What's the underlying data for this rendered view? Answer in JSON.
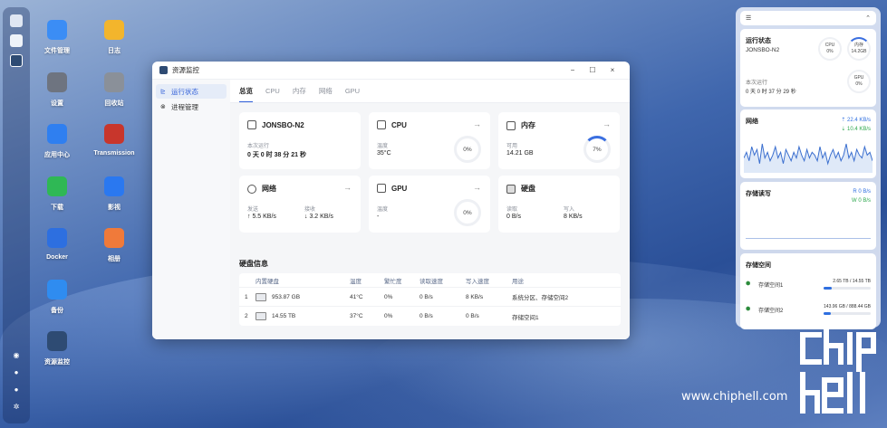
{
  "desktop": {
    "icons": [
      {
        "label": "文件管理",
        "icon": "folder-icon",
        "color": "#3b8df5"
      },
      {
        "label": "日志",
        "icon": "log-icon",
        "color": "#f3b52c"
      },
      {
        "label": "设置",
        "icon": "gear-icon",
        "color": "#6e7480"
      },
      {
        "label": "回收站",
        "icon": "recycle-icon",
        "color": "#8a9099"
      },
      {
        "label": "应用中心",
        "icon": "store-icon",
        "color": "#2f7ff0"
      },
      {
        "label": "Transmission",
        "icon": "transmission-icon",
        "color": "#c8362c"
      },
      {
        "label": "下载",
        "icon": "download-icon",
        "color": "#2fb855"
      },
      {
        "label": "影视",
        "icon": "video-icon",
        "color": "#2a78f0"
      },
      {
        "label": "Docker",
        "icon": "docker-icon",
        "color": "#2d6fe0"
      },
      {
        "label": "相册",
        "icon": "photos-icon",
        "color": "#f07a3a"
      },
      {
        "label": "备份",
        "icon": "backup-icon",
        "color": "#2f8cf0"
      },
      {
        "label": "资源监控",
        "icon": "monitor-icon",
        "color": "#2e4b73"
      }
    ]
  },
  "window": {
    "title": "资源监控",
    "sidebar": [
      {
        "label": "运行状态",
        "icon": "chart-icon"
      },
      {
        "label": "进程管理",
        "icon": "process-icon"
      }
    ],
    "tabs": [
      "总览",
      "CPU",
      "内存",
      "网络",
      "GPU"
    ],
    "cards": {
      "system": {
        "title": "JONSBO-N2",
        "label": "本次运行",
        "value": "0 天 0 时 38 分 21 秒"
      },
      "cpu": {
        "title": "CPU",
        "label": "温度",
        "value": "35°C",
        "gauge": "0%"
      },
      "memory": {
        "title": "内存",
        "label": "可用",
        "value": "14.21 GB",
        "gauge": "7%"
      },
      "network": {
        "title": "网络",
        "send_label": "发送",
        "send": "↑ 5.5 KB/s",
        "recv_label": "接收",
        "recv": "↓ 3.2 KB/s"
      },
      "gpu": {
        "title": "GPU",
        "label": "温度",
        "value": "-",
        "gauge": "0%"
      },
      "disk": {
        "title": "硬盘",
        "read_label": "读取",
        "read": "0 B/s",
        "write_label": "写入",
        "write": "8 KB/s"
      }
    },
    "disk_info": {
      "title": "硬盘信息",
      "headers": [
        "内置硬盘",
        "温度",
        "繁忙度",
        "读取速度",
        "写入速度",
        "用途"
      ],
      "rows": [
        {
          "index": "1",
          "size": "953.87 GB",
          "temp": "41°C",
          "busy": "0%",
          "read": "0 B/s",
          "write": "8 KB/s",
          "usage": "系统分区、存储空间2"
        },
        {
          "index": "2",
          "size": "14.55 TB",
          "temp": "37°C",
          "busy": "0%",
          "read": "0 B/s",
          "write": "0 B/s",
          "usage": "存储空间1"
        }
      ]
    }
  },
  "widgets": {
    "status": {
      "title": "运行状态",
      "host": "JONSBO-N2",
      "cpu_label": "CPU",
      "cpu": "0%",
      "mem_label": "内存",
      "mem": "14.2GB",
      "gpu_label": "GPU",
      "gpu": "0%",
      "uptime_label": "本次运行",
      "uptime": "0 天 0 时 37 分 29 秒"
    },
    "network": {
      "title": "网络",
      "up": "⇡ 22.4 KB/s",
      "down": "⇣ 10.4 KB/s",
      "series": [
        4,
        6,
        3,
        8,
        5,
        7,
        2,
        9,
        4,
        6,
        3,
        5,
        8,
        4,
        6,
        2,
        7,
        5,
        3,
        6,
        4,
        8,
        5,
        3,
        7,
        4,
        6,
        5,
        3,
        8,
        4,
        6,
        2,
        5,
        7,
        4,
        6,
        3,
        5,
        9,
        4,
        6,
        3,
        7,
        5,
        4,
        8,
        5,
        6,
        3
      ]
    },
    "storage_io": {
      "title": "存储读写",
      "read": "R 0 B/s",
      "write": "W 0 B/s"
    },
    "storage_space": {
      "title": "存储空间",
      "items": [
        {
          "name": "存储空间1",
          "usage": "2.65 TB / 14.55 TB",
          "fraction": 0.18
        },
        {
          "name": "存储空间2",
          "usage": "143.96 GB / 888.44 GB",
          "fraction": 0.16
        }
      ]
    }
  },
  "watermark": "www.chiphell.com"
}
